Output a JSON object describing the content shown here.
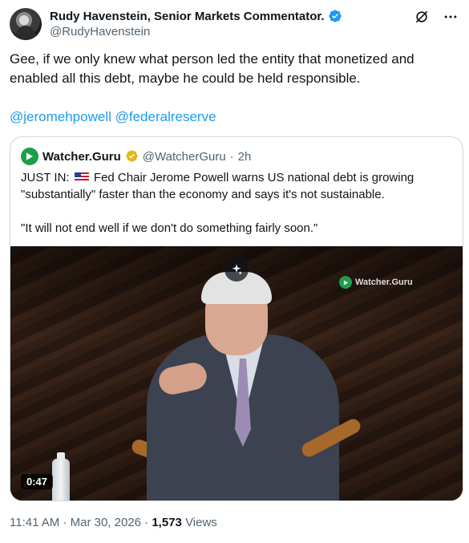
{
  "author": {
    "display_name": "Rudy Havenstein, Senior Markets Commentator.",
    "handle": "@RudyHavenstein",
    "verified_icon": "verified-badge-blue"
  },
  "header_actions": {
    "grok_icon": "grok-icon",
    "more_icon": "more-icon"
  },
  "tweet": {
    "text": "Gee, if we only knew what person led the entity that monetized and enabled all this debt, maybe he could be held responsible.",
    "mentions": [
      "@jeromehpowell",
      "@federalreserve"
    ]
  },
  "quote": {
    "display_name": "Watcher.Guru",
    "handle": "@WatcherGuru",
    "separator": "·",
    "time": "2h",
    "badge_icon": "verified-badge-gold",
    "text_prefix": "JUST IN:",
    "text_line1": "Fed Chair Jerome Powell warns US national debt is growing \"substantially\" faster than the economy and says it's not sustainable.",
    "text_line2": "\"It will not end well if we don't do something fairly soon.\"",
    "video": {
      "duration": "0:47",
      "watermark": "Watcher.Guru"
    }
  },
  "footer": {
    "time": "11:41 AM",
    "sep1": "·",
    "date": "Mar 30, 2026",
    "sep2": "·",
    "views_count": "1,573",
    "views_label": "Views"
  },
  "colors": {
    "link": "#1d9bf0",
    "verified_blue": "#1d9bf0",
    "verified_gold": "#e2b719",
    "secondary_text": "#536471"
  }
}
